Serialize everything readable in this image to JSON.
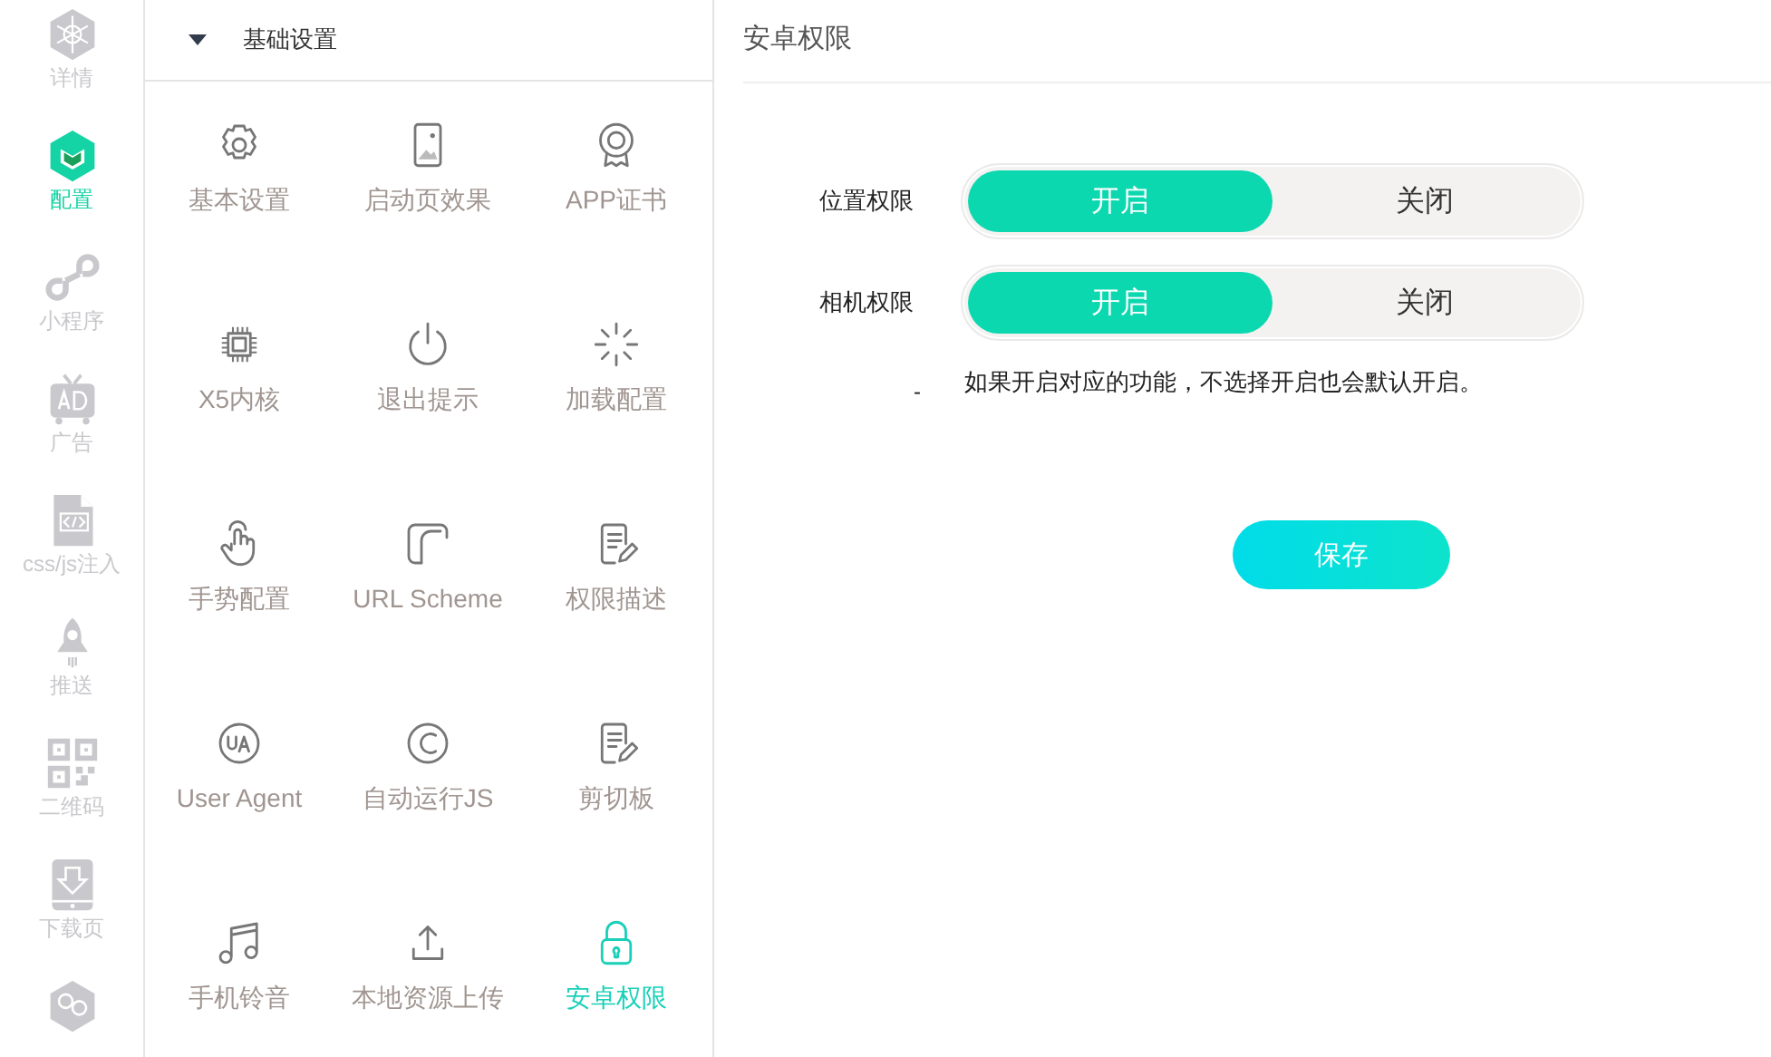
{
  "nav": [
    {
      "label": "详情",
      "selected": false
    },
    {
      "label": "配置",
      "selected": true
    },
    {
      "label": "小程序",
      "selected": false
    },
    {
      "label": "广告",
      "selected": false
    },
    {
      "label": "css/js注入",
      "selected": false
    },
    {
      "label": "推送",
      "selected": false
    },
    {
      "label": "二维码",
      "selected": false
    },
    {
      "label": "下载页",
      "selected": false
    },
    {
      "selected": false
    }
  ],
  "section": {
    "title": "基础设置",
    "expanded": true,
    "items": [
      {
        "label": "基本设置",
        "selected": false
      },
      {
        "label": "启动页效果",
        "selected": false
      },
      {
        "label": "APP证书",
        "selected": false
      },
      {
        "label": "X5内核",
        "selected": false
      },
      {
        "label": "退出提示",
        "selected": false
      },
      {
        "label": "加载配置",
        "selected": false
      },
      {
        "label": "手势配置",
        "selected": false
      },
      {
        "label": "URL Scheme",
        "selected": false
      },
      {
        "label": "权限描述",
        "selected": false
      },
      {
        "label": "User Agent",
        "selected": false
      },
      {
        "label": "自动运行JS",
        "selected": false
      },
      {
        "label": "剪切板",
        "selected": false
      },
      {
        "label": "手机铃音",
        "selected": false
      },
      {
        "label": "本地资源上传",
        "selected": false
      },
      {
        "label": "安卓权限",
        "selected": true
      }
    ]
  },
  "panel": {
    "title": "安卓权限",
    "permissions": [
      {
        "label": "位置权限",
        "options": [
          {
            "label": "开启",
            "selected": true
          },
          {
            "label": "关闭",
            "selected": false
          }
        ]
      },
      {
        "label": "相机权限",
        "options": [
          {
            "label": "开启",
            "selected": true
          },
          {
            "label": "关闭",
            "selected": false
          }
        ]
      }
    ],
    "note_mark": "-",
    "note": "如果开启对应的功能，不选择开启也会默认开启。",
    "save": "保存"
  }
}
